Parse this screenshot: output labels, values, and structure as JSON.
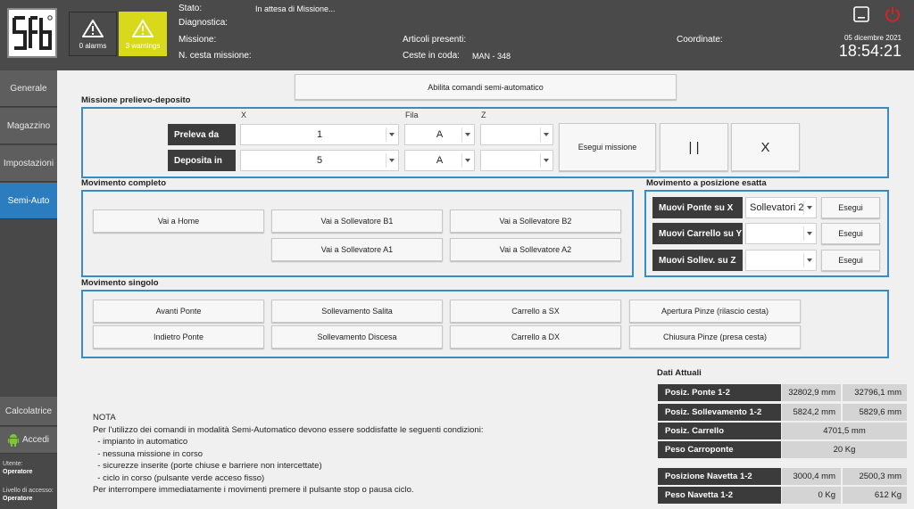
{
  "header": {
    "labels": {
      "stato": "Stato:",
      "diagnostica": "Diagnostica:",
      "missione": "Missione:",
      "n_cesta": "N. cesta missione:",
      "articoli": "Articoli presenti:",
      "ceste": "Ceste in coda:",
      "coordinate": "Coordinate:"
    },
    "values": {
      "stato": "In attesa di Missione...",
      "ceste": "MAN - 348"
    },
    "alarms_label": "0 alarms",
    "warnings_label": "3 warnings",
    "date": "05 dicembre 2021",
    "time": "18:54:21"
  },
  "sidebar": {
    "items": [
      "Generale",
      "Magazzino",
      "Impostazioni",
      "Semi-Auto"
    ],
    "active": "Semi-Auto",
    "calcolatrice": "Calcolatrice",
    "accedi": "Accedi",
    "utente_label": "Utente:",
    "utente_value": "Operatore",
    "livello_label": "Livello di accesso:",
    "livello_value": "Operatore"
  },
  "main": {
    "abilita_button": "Abilita comandi semi-automatico",
    "prelievo": {
      "title": "Missione prelievo-deposito",
      "col_x": "X",
      "col_fila": "Fila",
      "col_z": "Z",
      "preleva_label": "Preleva da",
      "deposita_label": "Deposita in",
      "preleva_x": "1",
      "preleva_fila": "A",
      "preleva_z": "",
      "deposita_x": "5",
      "deposita_fila": "A",
      "deposita_z": "",
      "esegui": "Esegui missione",
      "pause": "| |",
      "stop": "X"
    },
    "completo": {
      "title": "Movimento completo",
      "home": "Vai a Home",
      "b1": "Vai a Sollevatore B1",
      "b2": "Vai a Sollevatore B2",
      "a1": "Vai a Sollevatore A1",
      "a2": "Vai a Sollevatore A2"
    },
    "esatta": {
      "title": "Movimento a posizione esatta",
      "ponte_label": "Muovi Ponte su X",
      "ponte_value": "Sollevatori 2",
      "carrello_label": "Muovi Carrello su Y",
      "carrello_value": "",
      "sollev_label": "Muovi Sollev. su Z",
      "sollev_value": "",
      "esegui": "Esegui"
    },
    "singolo": {
      "title": "Movimento singolo",
      "avanti": "Avanti Ponte",
      "indietro": "Indietro Ponte",
      "salita": "Sollevamento Salita",
      "discesa": "Sollevamento Discesa",
      "sx": "Carrello a SX",
      "dx": "Carrello a DX",
      "apertura": "Apertura Pinze (rilascio cesta)",
      "chiusura": "Chiusura Pinze (presa cesta)"
    },
    "dati": {
      "title": "Dati Attuali",
      "ponte_label": "Posiz. Ponte 1-2",
      "ponte_1": "32802,9 mm",
      "ponte_2": "32796,1 mm",
      "sollev_label": "Posiz. Sollevamento 1-2",
      "sollev_1": "5824,2 mm",
      "sollev_2": "5829,6 mm",
      "carrello_label": "Posiz. Carrello",
      "carrello": "4701,5 mm",
      "peso_carr_label": "Peso Carroponte",
      "peso_carr": "20 Kg",
      "navetta_label": "Posizione Navetta 1-2",
      "navetta_1": "3000,4 mm",
      "navetta_2": "2500,3 mm",
      "peso_nav_label": "Peso Navetta 1-2",
      "peso_nav_1": "0 Kg",
      "peso_nav_2": "612 Kg"
    },
    "note": {
      "title": "NOTA",
      "l1": "Per l'utilizzo dei comandi in modalità Semi-Automatico devono essere soddisfatte le seguenti condizioni:",
      "l2": "  - impianto in automatico",
      "l3": "  - nessuna missione in corso",
      "l4": "  - sicurezze inserite (porte chiuse e barriere non intercettate)",
      "l5": "  - ciclo in corso (pulsante verde acceso fisso)",
      "l6": "Per interrompere immediatamente i movimenti premere il pulsante stop o pausa ciclo."
    }
  },
  "colors": {
    "header_bg": "#4a4a4a",
    "accent_blue": "#2b7dbf",
    "warning_yellow": "#d7d91a",
    "power_red": "#e02020"
  }
}
